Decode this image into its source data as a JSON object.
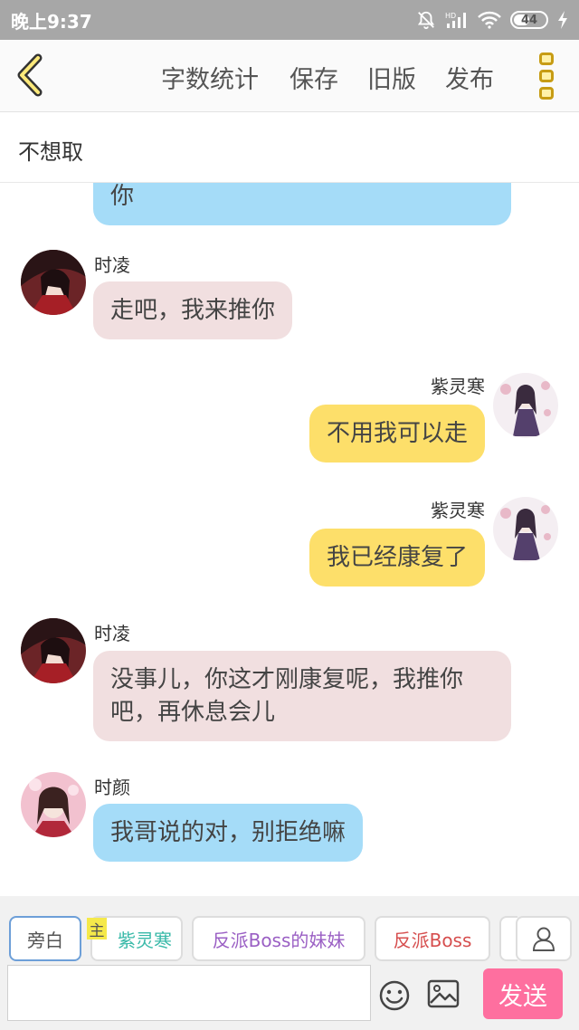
{
  "status_bar": {
    "time": "晚上9:37",
    "signal_label": "HD",
    "battery": "44"
  },
  "toolbar": {
    "word_count": "字数统计",
    "save": "保存",
    "old_version": "旧版",
    "publish": "发布"
  },
  "title": "不想取",
  "chat": {
    "partial_message": "你",
    "messages": [
      {
        "speaker": "时凌",
        "text": "走吧，我来推你",
        "side": "left",
        "color": "pink"
      },
      {
        "speaker": "紫灵寒",
        "text": "不用我可以走",
        "side": "right",
        "color": "yellow"
      },
      {
        "speaker": "紫灵寒",
        "text": "我已经康复了",
        "side": "right",
        "color": "yellow"
      },
      {
        "speaker": "时凌",
        "text": "没事儿，你这才刚康复呢，我推你吧，再休息会儿",
        "side": "left",
        "color": "pink"
      },
      {
        "speaker": "时颜",
        "text": "我哥说的对，别拒绝嘛",
        "side": "left",
        "color": "blue"
      }
    ]
  },
  "roles": {
    "narrator": "旁白",
    "master_badge": "主",
    "role1": "紫灵寒",
    "role2": "反派Boss的妹妹",
    "role3": "反派Boss"
  },
  "input": {
    "value": "",
    "placeholder": ""
  },
  "send": "发送",
  "colors": {
    "accent_yellow": "#fddf6a",
    "bubble_pink": "#f1dfe0",
    "bubble_blue": "#a5dcf8",
    "send_pink": "#fe6f9f",
    "role1_color": "#38b9a8",
    "role2_color": "#9a5fc4",
    "role3_color": "#d64e4e"
  },
  "icons": [
    "back-icon",
    "menu-icon",
    "bell-off-icon",
    "signal-icon",
    "wifi-icon",
    "battery-icon",
    "charge-icon",
    "emoji-icon",
    "image-icon",
    "person-icon"
  ]
}
